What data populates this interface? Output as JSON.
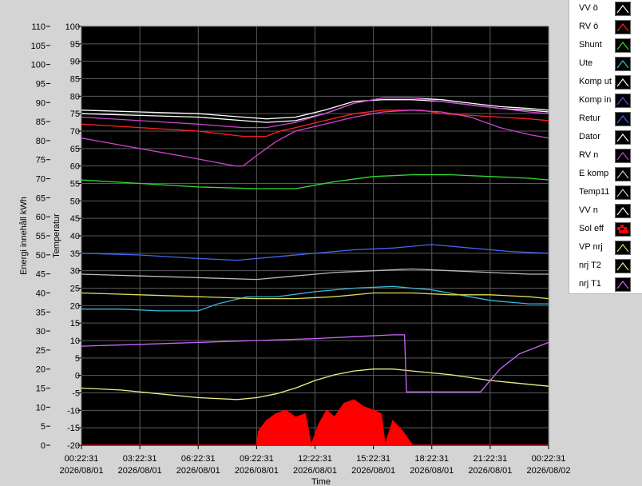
{
  "chart_data": {
    "type": "line",
    "ylabel_left": "Energi innehåll kWh",
    "ylabel_right": "Temperatur",
    "xlabel": "Time",
    "energy_ticks": [
      "110",
      "105",
      "100",
      "95",
      "90",
      "85",
      "80",
      "75",
      "70",
      "65",
      "60",
      "55",
      "50",
      "45",
      "40",
      "35",
      "30",
      "25",
      "20",
      "15",
      "10",
      "5",
      "0"
    ],
    "temp_ticks": [
      "100",
      "95",
      "90",
      "85",
      "80",
      "75",
      "70",
      "65",
      "60",
      "55",
      "50",
      "45",
      "40",
      "35",
      "30",
      "25",
      "20",
      "15",
      "10",
      "5",
      "0",
      "-5",
      "-10",
      "-15",
      "-20"
    ],
    "time_ticks": [
      {
        "time": "00:22:31",
        "date": "2026/08/01"
      },
      {
        "time": "03:22:31",
        "date": "2026/08/01"
      },
      {
        "time": "06:22:31",
        "date": "2026/08/01"
      },
      {
        "time": "09:22:31",
        "date": "2026/08/01"
      },
      {
        "time": "12:22:31",
        "date": "2026/08/01"
      },
      {
        "time": "15:22:31",
        "date": "2026/08/01"
      },
      {
        "time": "18:22:31",
        "date": "2026/08/01"
      },
      {
        "time": "21:22:31",
        "date": "2026/08/01"
      },
      {
        "time": "00:22:31",
        "date": "2026/08/02"
      }
    ],
    "energy_range": [
      0,
      110
    ],
    "temp_range": [
      -20,
      100
    ],
    "x_range_hours": [
      0,
      24
    ],
    "grid": true,
    "legend_position": "right",
    "series": [
      {
        "name": "VV ö",
        "color": "#ffffff",
        "axis": "temp",
        "x": [
          0,
          3,
          6,
          8.3,
          9.5,
          11,
          12.5,
          14,
          15.5,
          17,
          18.5,
          20,
          21.5,
          23,
          24
        ],
        "y": [
          75,
          74.5,
          74,
          73,
          72.5,
          73,
          75,
          78,
          79.5,
          79.5,
          79,
          78,
          77,
          76.5,
          76
        ]
      },
      {
        "name": "RV ö",
        "color": "#ff2020",
        "axis": "temp",
        "x": [
          0,
          3,
          6,
          8.3,
          9.5,
          10.2,
          11,
          12.5,
          14,
          15.5,
          16.5,
          17.5,
          18.5,
          20,
          21.5,
          23,
          24
        ],
        "y": [
          72,
          71,
          70,
          68.5,
          68.5,
          70,
          71,
          73,
          75,
          76,
          76,
          76,
          75,
          74.5,
          74,
          73.5,
          73
        ]
      },
      {
        "name": "Shunt",
        "color": "#33dd33",
        "axis": "temp",
        "x": [
          0,
          3,
          6,
          9,
          11,
          13,
          15,
          17,
          19,
          21,
          23,
          24
        ],
        "y": [
          56,
          55,
          54,
          53.5,
          53.5,
          55.5,
          57,
          57.5,
          57.5,
          57,
          56.5,
          56
        ]
      },
      {
        "name": "Ute",
        "color": "#33bbdd",
        "axis": "temp",
        "x": [
          0,
          2,
          4,
          6,
          7,
          8.5,
          10,
          12,
          14,
          16,
          18,
          19.5,
          21,
          22,
          23,
          24
        ],
        "y": [
          19,
          19,
          18.5,
          18.5,
          20.5,
          22.5,
          22.5,
          24,
          25,
          25.5,
          24.5,
          23,
          21.5,
          21,
          20.5,
          20.5
        ]
      },
      {
        "name": "Komp ut",
        "color": "#ffffff",
        "axis": "temp",
        "x": [
          0,
          3,
          6,
          8.3,
          9.5,
          11,
          12.5,
          14,
          15.5,
          17,
          18.5,
          20,
          21.5,
          23,
          24
        ],
        "y": [
          76,
          75.5,
          75,
          74,
          73.5,
          74,
          76,
          78.5,
          79,
          79,
          78.5,
          77.5,
          76.5,
          76,
          75.5
        ]
      },
      {
        "name": "Komp in",
        "color": "#cc44cc",
        "axis": "temp",
        "x": [
          0,
          3,
          6,
          8.3,
          9.5,
          11,
          12.5,
          14,
          15.5,
          17,
          18.5,
          20,
          21.5,
          23,
          24
        ],
        "y": [
          74,
          73,
          72,
          71,
          71,
          72.5,
          75,
          78,
          79.5,
          79.5,
          78.5,
          77.5,
          76.5,
          75.5,
          75
        ]
      },
      {
        "name": "Retur",
        "color": "#4466ee",
        "axis": "temp",
        "x": [
          0,
          3,
          6,
          8,
          10,
          12,
          14,
          16,
          18,
          20,
          22,
          24
        ],
        "y": [
          35,
          34.5,
          33.5,
          33,
          34,
          35,
          36,
          36.5,
          37.5,
          36.5,
          35.5,
          35
        ]
      },
      {
        "name": "Dator",
        "color": "#bbbbbb",
        "axis": "temp",
        "x": [
          0,
          3,
          6,
          9,
          11,
          13,
          15,
          17,
          19,
          21,
          23,
          24
        ],
        "y": [
          29,
          28.5,
          28,
          27.5,
          28.5,
          29.5,
          30,
          30.5,
          30,
          29.5,
          29,
          29
        ]
      },
      {
        "name": "RV n",
        "color": "#cc44cc",
        "axis": "temp",
        "x": [
          0,
          2,
          4,
          6,
          7.9,
          8.3,
          9,
          10,
          11,
          12.5,
          14,
          15.5,
          17,
          18.5,
          20,
          21.5,
          23,
          24
        ],
        "y": [
          68,
          66,
          64,
          62,
          60,
          60,
          63,
          67,
          70,
          72,
          74,
          75.5,
          76,
          75.5,
          74,
          71,
          69,
          68
        ]
      },
      {
        "name": "E komp",
        "color": "#222222",
        "axis": "temp",
        "x": [
          0,
          24
        ],
        "y": [
          -20,
          -20
        ]
      },
      {
        "name": "Temp11",
        "color": "#222222",
        "axis": "temp",
        "x": [
          0,
          24
        ],
        "y": [
          -20,
          -20
        ]
      },
      {
        "name": "VV n",
        "color": "#222222",
        "axis": "temp",
        "x": [
          0,
          24
        ],
        "y": [
          -20,
          -20
        ]
      },
      {
        "name": "Sol eff",
        "color": "#ff0000",
        "axis": "temp",
        "x": [
          0,
          9.0,
          9.1,
          9.5,
          10,
          10.5,
          11,
          11.5,
          11.8,
          12.2,
          12.6,
          13,
          13.5,
          14,
          14.5,
          15,
          15.4,
          15.6,
          16,
          16.5,
          17,
          24
        ],
        "y": [
          -20,
          -20,
          -16,
          -13,
          -11,
          -10,
          -12,
          -11,
          -20,
          -14,
          -10,
          -12,
          -8,
          -7,
          -9,
          -10,
          -11,
          -20,
          -13,
          -16,
          -20,
          -20
        ]
      },
      {
        "name": "VP nrj",
        "color": "#dddd55",
        "axis": "energy",
        "x": [
          0,
          3,
          6,
          9,
          11,
          13,
          15,
          17,
          19,
          21,
          23,
          24
        ],
        "y": [
          40,
          39.5,
          39,
          38.5,
          38.5,
          39,
          40,
          40,
          39.5,
          39.5,
          39,
          38.5
        ]
      },
      {
        "name": "nrj T2",
        "color": "#eeee88",
        "axis": "energy",
        "x": [
          0,
          2,
          4,
          6,
          8,
          9,
          10,
          11,
          12,
          13,
          14,
          15,
          16,
          17,
          19,
          21,
          23,
          24
        ],
        "y": [
          15,
          14.5,
          13.5,
          12.5,
          12,
          12.5,
          13.5,
          15,
          17,
          18.5,
          19.5,
          20,
          20,
          19.5,
          18.5,
          17,
          16,
          15.5
        ]
      },
      {
        "name": "nrj T1",
        "color": "#cc66ff",
        "axis": "energy",
        "x": [
          0,
          3,
          6,
          9,
          12,
          14,
          16,
          16.6,
          16.7,
          17,
          19,
          20.5,
          21.5,
          22.5,
          24
        ],
        "y": [
          26,
          26.5,
          27,
          27.5,
          28,
          28.5,
          29,
          29,
          14,
          14,
          14,
          14,
          20,
          24,
          27
        ]
      }
    ]
  },
  "legend_items": [
    {
      "label": "VV ö",
      "color": "#ffffff",
      "style": "line"
    },
    {
      "label": "RV ö",
      "color": "#ff2020",
      "style": "line"
    },
    {
      "label": "Shunt",
      "color": "#33dd33",
      "style": "line"
    },
    {
      "label": "Ute",
      "color": "#33bbdd",
      "style": "line"
    },
    {
      "label": "Komp ut",
      "color": "#ffffff",
      "style": "line"
    },
    {
      "label": "Komp in",
      "color": "#6a4ae0",
      "style": "line"
    },
    {
      "label": "Retur",
      "color": "#4466ee",
      "style": "line"
    },
    {
      "label": "Dator",
      "color": "#ffffff",
      "style": "line"
    },
    {
      "label": "RV n",
      "color": "#cc44cc",
      "style": "line"
    },
    {
      "label": "E komp",
      "color": "#cccccc",
      "style": "line"
    },
    {
      "label": "Temp11",
      "color": "#cccccc",
      "style": "line"
    },
    {
      "label": "VV n",
      "color": "#ffffff",
      "style": "line"
    },
    {
      "label": "Sol eff",
      "color": "#ff0000",
      "style": "fill"
    },
    {
      "label": "VP nrj",
      "color": "#dddd55",
      "style": "line"
    },
    {
      "label": "nrj T2",
      "color": "#eeee88",
      "style": "line"
    },
    {
      "label": "nrj T1",
      "color": "#cc66ff",
      "style": "line"
    }
  ]
}
